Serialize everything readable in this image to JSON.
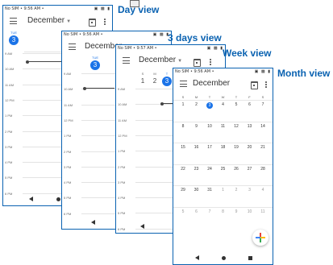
{
  "labels": {
    "day_view": "Day view",
    "three_days_view": "3 days view",
    "week_view": "Week view",
    "month_view": "Month view"
  },
  "day_view": {
    "status_left": "No SIM • 9:56 AM  •",
    "status_right": "▣ ▩ ▮",
    "month": "December",
    "day_name": "TUE",
    "day_number": "3",
    "hours": [
      "9 AM",
      "10 AM",
      "11 AM",
      "12 PM",
      "1 PM",
      "2 PM",
      "3 PM",
      "4 PM",
      "5 PM",
      "6 PM"
    ]
  },
  "three_days_view": {
    "status_left": "No SIM • 9:56 AM  •",
    "status_right": "▣ ▩ ▮",
    "month": "December",
    "day_name": "TUE",
    "day_number": "3",
    "hours": [
      "9 AM",
      "10 AM",
      "11 AM",
      "12 PM",
      "1 PM",
      "2 PM",
      "3 PM",
      "4 PM",
      "5 PM",
      "6 PM"
    ]
  },
  "week_view": {
    "status_left": "No SIM • 9:57 AM  •",
    "status_right": "▣ ▩ ▮",
    "month": "December",
    "days": [
      {
        "name": "S",
        "num": "1"
      },
      {
        "name": "M",
        "num": "2"
      },
      {
        "name": "T",
        "num": "3"
      }
    ],
    "hours": [
      "9 AM",
      "10 AM",
      "11 AM",
      "12 PM",
      "1 PM",
      "2 PM",
      "3 PM",
      "4 PM",
      "5 PM",
      "6 PM"
    ]
  },
  "month_view": {
    "status_left": "No SIM • 9:56 AM  •",
    "status_right": "▣ ▩ ▮",
    "month": "December",
    "weekdays": [
      "S",
      "M",
      "T",
      "W",
      "T",
      "F",
      "S"
    ],
    "weeks": [
      [
        "1",
        "2",
        "3",
        "4",
        "5",
        "6",
        "7"
      ],
      [
        "8",
        "9",
        "10",
        "11",
        "12",
        "13",
        "14"
      ],
      [
        "15",
        "16",
        "17",
        "18",
        "19",
        "20",
        "21"
      ],
      [
        "22",
        "23",
        "24",
        "25",
        "26",
        "27",
        "28"
      ],
      [
        "29",
        "30",
        "31",
        "1",
        "2",
        "3",
        "4"
      ],
      [
        "5",
        "6",
        "7",
        "8",
        "9",
        "10",
        "11"
      ]
    ],
    "today": "3"
  },
  "colors": {
    "accent": "#1a73e8",
    "label": "#0a62b1",
    "frame": "#0a62b1"
  }
}
